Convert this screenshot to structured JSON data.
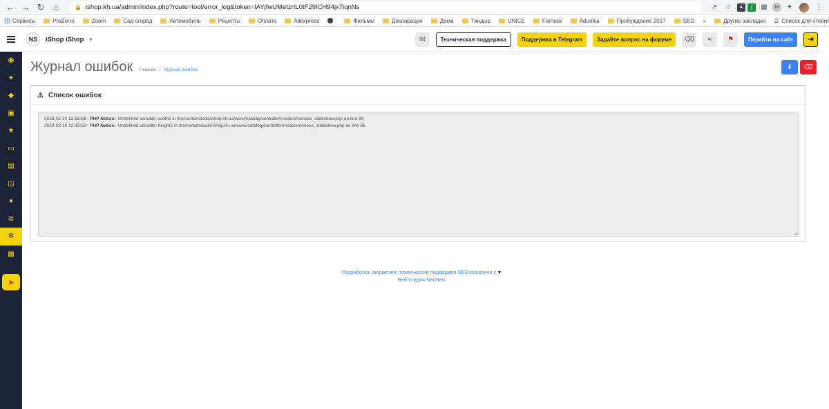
{
  "browser": {
    "url": "ishop.kh.ua/admin/index.php?route=tool/error_log&token=lAYjfwUMetzrtL0tF29ICH94jx7iqnNs",
    "bookmarks": [
      "Сервисы",
      "ProZorro",
      "Zoom",
      "Сад огород",
      "Автомобиль",
      "Рецепты",
      "Оплата",
      "Aliexpress",
      "Фильмы",
      "Декларация",
      "Дома",
      "Тандыр",
      "UNICE",
      "Farmasi",
      "Adurilka",
      "Пробуждение 2017",
      "SEO"
    ],
    "other_bookmarks": "Другие закладки",
    "reading_list": "Список для чтения"
  },
  "topbar": {
    "logo": "NS",
    "store_name": "iShop iShop",
    "tech_support": "Техническая поддержка",
    "telegram_support": "Поддержка в Telegram",
    "forum_question": "Задайте вопрос на форуме",
    "go_to_site": "Перейти на сайт"
  },
  "page": {
    "title": "Журнал ошибок",
    "breadcrumb_home": "Главная",
    "breadcrumb_sep": "/",
    "breadcrumb_current": "Журнал ошибок"
  },
  "panel": {
    "title": "Список ошибок",
    "log": [
      {
        "time": "2022-02-10 12:33:58",
        "type": "PHP Notice:",
        "message": "Undefined variable: width2 in /home/admdodo/ishop.kh.ua/www/catalog/controller/module/neoseo_slideshow.php on line 85"
      },
      {
        "time": "2022-02-10 12:33:58",
        "type": "PHP Notice:",
        "message": "Undefined variable: height2 in /home/admdodo/ishop.kh.ua/www/catalog/controller/module/neoseo_slideshow.php on line 86"
      }
    ]
  },
  "footer": {
    "line1": "Разработка, маркетинг, техническая поддержка SEO-магазина с",
    "heart": "♥",
    "line2": "Веб-студия NeoSeo"
  },
  "sidebar": {
    "items": [
      "dashboard-icon",
      "magic-wand-icon",
      "tags-icon",
      "puzzle-icon",
      "star-icon",
      "desktop-icon",
      "document-icon",
      "cart-icon",
      "user-icon",
      "share-icon",
      "settings-icon",
      "chart-icon"
    ],
    "active_index": 10
  },
  "colors": {
    "sidebar": "#1d2336",
    "accent_yellow": "#f5d30c",
    "primary_blue": "#3b82f6",
    "danger_red": "#e8212d"
  }
}
